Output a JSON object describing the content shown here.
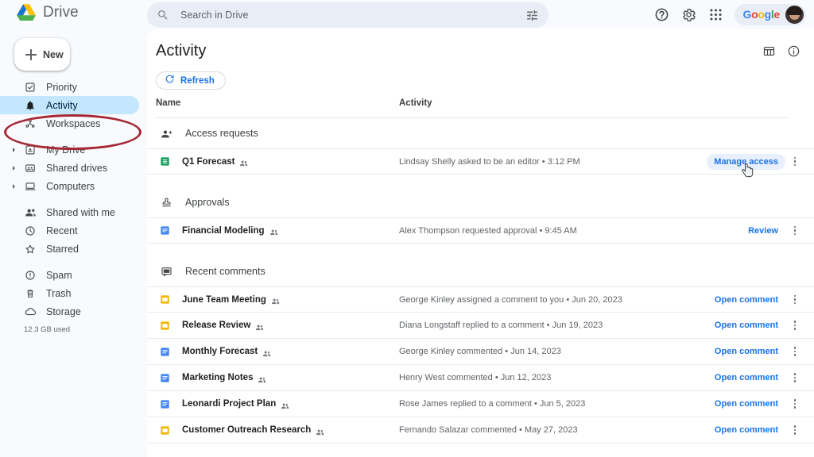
{
  "app": {
    "brand_name": "Drive"
  },
  "search": {
    "placeholder": "Search in Drive",
    "value": "",
    "search_icon": "search-icon",
    "tune_icon": "tune-icon"
  },
  "topbar": {
    "help_icon": "help-icon",
    "settings_icon": "gear-icon",
    "apps_icon": "apps-grid-icon",
    "google_logo": "Google",
    "google_letters": [
      "G",
      "o",
      "o",
      "g",
      "l",
      "e"
    ],
    "avatar": "user-avatar"
  },
  "sidebar": {
    "new_button_label": "New",
    "new_button_icon": "plus-icon",
    "items": [
      {
        "label": "Priority",
        "icon": "priority-check-icon",
        "active": false,
        "expandable": false
      },
      {
        "label": "Activity",
        "icon": "bell-icon",
        "active": true,
        "expandable": false
      },
      {
        "label": "Workspaces",
        "icon": "workspaces-icon",
        "active": false,
        "expandable": false
      },
      {
        "label": "My Drive",
        "icon": "my-drive-icon",
        "active": false,
        "expandable": true
      },
      {
        "label": "Shared drives",
        "icon": "shared-drives-icon",
        "active": false,
        "expandable": true
      },
      {
        "label": "Computers",
        "icon": "computer-icon",
        "active": false,
        "expandable": true
      },
      {
        "label": "Shared with me",
        "icon": "people-icon",
        "active": false,
        "expandable": false
      },
      {
        "label": "Recent",
        "icon": "clock-icon",
        "active": false,
        "expandable": false
      },
      {
        "label": "Starred",
        "icon": "star-icon",
        "active": false,
        "expandable": false
      },
      {
        "label": "Spam",
        "icon": "spam-icon",
        "active": false,
        "expandable": false
      },
      {
        "label": "Trash",
        "icon": "trash-icon",
        "active": false,
        "expandable": false
      },
      {
        "label": "Storage",
        "icon": "cloud-icon",
        "active": false,
        "expandable": false
      }
    ],
    "storage_used": "12.3 GB used"
  },
  "annotation": {
    "type": "ellipse-highlight",
    "target": "Activity",
    "color": "#a52834"
  },
  "main": {
    "title": "Activity",
    "refresh_label": "Refresh",
    "refresh_icon": "refresh-icon",
    "grid_view_icon": "grid-view-icon",
    "info_icon": "info-icon",
    "columns": {
      "name": "Name",
      "activity": "Activity"
    },
    "sections": [
      {
        "title": "Access requests",
        "icon": "person-add-icon",
        "rows": [
          {
            "name": "Q1 Forecast",
            "file_icon": "sheets-icon",
            "file_color": "#0f9d58",
            "shared": true,
            "activity": "Lindsay Shelly asked to be an editor • 3:12 PM",
            "action": "Manage access",
            "action_style": "pill",
            "menu_icon": "more-vert-icon"
          }
        ]
      },
      {
        "title": "Approvals",
        "icon": "approval-stamp-icon",
        "rows": [
          {
            "name": "Financial Modeling",
            "file_icon": "docs-icon",
            "file_color": "#4285f4",
            "shared": true,
            "activity": "Alex Thompson requested approval • 9:45 AM",
            "action": "Review",
            "action_style": "link",
            "menu_icon": "more-vert-icon"
          }
        ]
      },
      {
        "title": "Recent comments",
        "icon": "comment-icon",
        "rows": [
          {
            "name": "June Team Meeting",
            "file_icon": "slides-icon",
            "file_color": "#f4b400",
            "shared": true,
            "activity": "George Kinley assigned a comment to you • Jun 20, 2023",
            "action": "Open comment",
            "action_style": "link",
            "menu_icon": "more-vert-icon"
          },
          {
            "name": "Release Review",
            "file_icon": "slides-icon",
            "file_color": "#f4b400",
            "shared": true,
            "activity": "Diana Longstaff replied to a comment • Jun 19, 2023",
            "action": "Open comment",
            "action_style": "link",
            "menu_icon": "more-vert-icon"
          },
          {
            "name": "Monthly Forecast",
            "file_icon": "docs-icon",
            "file_color": "#4285f4",
            "shared": true,
            "activity": "George Kinley commented • Jun 14, 2023",
            "action": "Open comment",
            "action_style": "link",
            "menu_icon": "more-vert-icon"
          },
          {
            "name": "Marketing Notes",
            "file_icon": "docs-icon",
            "file_color": "#4285f4",
            "shared": true,
            "activity": "Henry West commented • Jun 12, 2023",
            "action": "Open comment",
            "action_style": "link",
            "menu_icon": "more-vert-icon"
          },
          {
            "name": "Leonardi Project Plan",
            "file_icon": "docs-icon",
            "file_color": "#4285f4",
            "shared": true,
            "activity": "Rose James replied to a comment • Jun 5, 2023",
            "action": "Open comment",
            "action_style": "link",
            "menu_icon": "more-vert-icon"
          },
          {
            "name": "Customer Outreach Research",
            "file_icon": "slides-icon",
            "file_color": "#f4b400",
            "shared": true,
            "activity": "Fernando Salazar commented • May 27, 2023",
            "action": "Open comment",
            "action_style": "link",
            "menu_icon": "more-vert-icon"
          }
        ]
      }
    ]
  },
  "colors": {
    "accent_blue": "#1a73e8",
    "active_nav": "#c2e7ff",
    "panel_bg": "#ffffff",
    "page_bg": "#f8fafd",
    "search_bg": "#e9eef6"
  }
}
